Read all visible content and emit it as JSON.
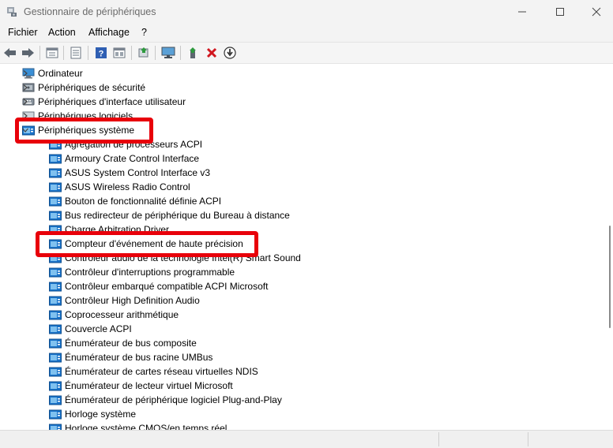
{
  "window": {
    "title": "Gestionnaire de périphériques"
  },
  "menu": [
    "Fichier",
    "Action",
    "Affichage",
    "?"
  ],
  "toolbar": {
    "buttons": [
      "back-arrow-icon",
      "forward-arrow-icon",
      "properties-icon",
      "list-view-icon",
      "help-icon",
      "resource-view-icon",
      "export-icon",
      "monitor-icon",
      "add-driver-icon",
      "uninstall-icon",
      "update-driver-icon"
    ]
  },
  "tree": {
    "categories": [
      {
        "label": "Ordinateur",
        "expanded": false
      },
      {
        "label": "Périphériques de sécurité",
        "expanded": false
      },
      {
        "label": "Périphériques d'interface utilisateur",
        "expanded": false
      },
      {
        "label": "Périphériques logiciels",
        "expanded": false
      },
      {
        "label": "Périphériques système",
        "expanded": true
      }
    ],
    "system_devices": [
      "Agrégation de processeurs ACPI",
      "Armoury Crate Control Interface",
      "ASUS System Control Interface v3",
      "ASUS Wireless Radio Control",
      "Bouton de fonctionnalité définie ACPI",
      "Bus redirecteur de périphérique du Bureau à distance",
      "Charge Arbitration Driver",
      "Compteur d'événement de haute précision",
      "Contrôleur audio de la technologie Intel(R) Smart Sound",
      "Contrôleur d'interruptions programmable",
      "Contrôleur embarqué compatible ACPI Microsoft",
      "Contrôleur High Definition Audio",
      "Coprocesseur arithmétique",
      "Couvercle ACPI",
      "Énumérateur de bus composite",
      "Énumérateur de bus racine UMBus",
      "Énumérateur de cartes réseau virtuelles NDIS",
      "Énumérateur de lecteur virtuel Microsoft",
      "Énumérateur de périphérique logiciel Plug-and-Play",
      "Horloge système",
      "Horloge système CMOS/en temps réel"
    ]
  },
  "colors": {
    "highlight": "#e8000a",
    "folder_blue": "#1a73c9"
  }
}
